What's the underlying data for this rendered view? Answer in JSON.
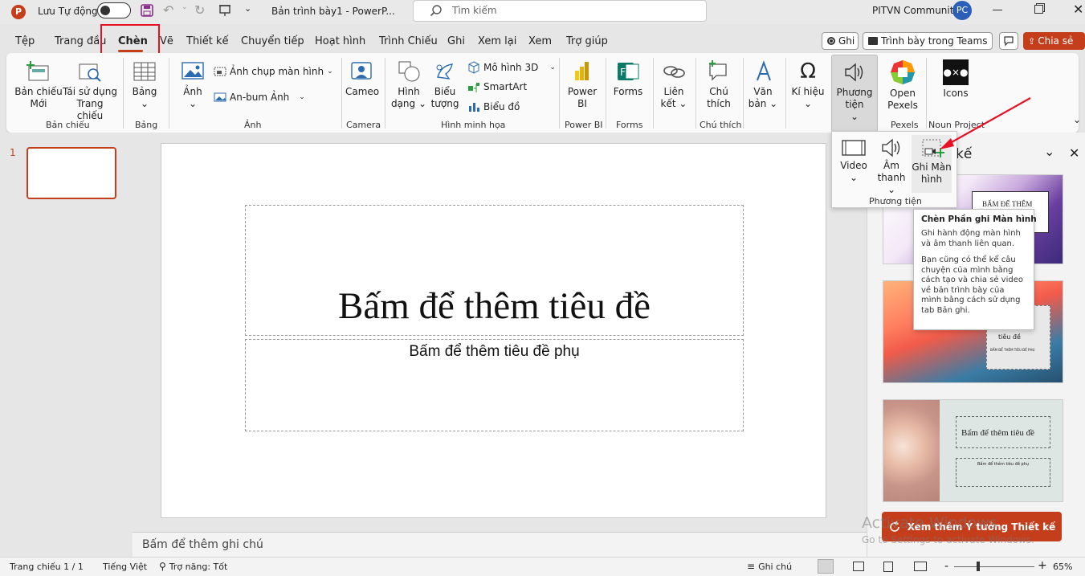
{
  "titlebar": {
    "autosave_label": "Lưu Tự động",
    "doc_title": "Bản trình bày1  -  PowerP...",
    "search_placeholder": "Tìm kiếm",
    "account_name": "PITVN Community",
    "avatar_initials": "PC"
  },
  "tabs": [
    "Tệp",
    "Trang đầu",
    "Chèn",
    "Vẽ",
    "Thiết kế",
    "Chuyển tiếp",
    "Hoạt hình",
    "Trình Chiếu",
    "Ghi",
    "Xem lại",
    "Xem",
    "Trợ giúp"
  ],
  "tab_actions": {
    "record": "Ghi",
    "teams": "Trình bày trong Teams",
    "share": "Chia sẻ"
  },
  "ribbon": {
    "new_slide": "Bản chiếu Mới",
    "reuse_slides": "Tái sử dụng Trang chiếu",
    "table": "Bảng",
    "pictures": "Ảnh",
    "screenshot": "Ảnh chụp màn hình",
    "photo_album": "An-bum Ảnh",
    "cameo": "Cameo",
    "shapes": "Hình dạng",
    "icons": "Biểu tượng",
    "model3d": "Mô hình 3D",
    "smartart": "SmartArt",
    "chart": "Biểu đồ",
    "powerbi": "Power BI",
    "forms": "Forms",
    "link": "Liên kết",
    "comment": "Chú thích",
    "text": "Văn bản",
    "symbols": "Kí hiệu",
    "media": "Phương tiện",
    "open_pexels": "Open Pexels",
    "noun_icons": "Icons",
    "groups": {
      "slides": "Bản chiếu",
      "tables": "Bảng",
      "images": "Ảnh",
      "camera": "Camera",
      "illustrations": "Hình minh họa",
      "powerbi": "Power BI",
      "forms": "Forms",
      "comments": "Chú thích",
      "pexels": "Pexels",
      "noun": "Noun Project"
    }
  },
  "media_dropdown": {
    "video": "Video",
    "audio": "Âm thanh",
    "screen_recording": "Ghi Màn hình",
    "group": "Phương tiện"
  },
  "tooltip": {
    "title": "Chèn Phần ghi Màn hình",
    "line1": "Ghi hành động màn hình và âm thanh liên quan.",
    "line2": "Bạn cũng có thể kể câu chuyện của mình bằng cách tạo và chia sẻ video về bản trình bày của mình bằng cách sử dụng tab Bản ghi."
  },
  "thumbnail_number": "1",
  "slide": {
    "title": "Bấm để thêm tiêu đề",
    "subtitle": "Bấm để thêm tiêu đề phụ"
  },
  "notes_placeholder": "Bấm để thêm ghi chú",
  "designer": {
    "title_fragment": "kế",
    "d1_title": "BẤM ĐỂ THÊM",
    "d2_title": "tiêu đề",
    "d2_sub": "BẤM ĐỂ THÊM TIÊU ĐỀ PHỤ",
    "d3_title": "Bấm để thêm tiêu đề",
    "d3_sub": "Bấm để thêm tiêu đề phụ",
    "more_button": "Xem thêm Ý tưởng Thiết kế"
  },
  "watermark": {
    "line1": "Activate Windows",
    "line2": "Go to Settings to activate Windows."
  },
  "statusbar": {
    "slide_info": "Trang chiếu 1 / 1",
    "language": "Tiếng Việt",
    "accessibility": "Trợ năng: Tốt",
    "notes": "Ghi chú",
    "zoom": "65%",
    "minus": "-",
    "plus": "+"
  },
  "colors": {
    "accent": "#c43e1c",
    "highlight": "#e81123",
    "window_bg": "#e6e6e6",
    "ribbon_bg": "#fafafa"
  }
}
